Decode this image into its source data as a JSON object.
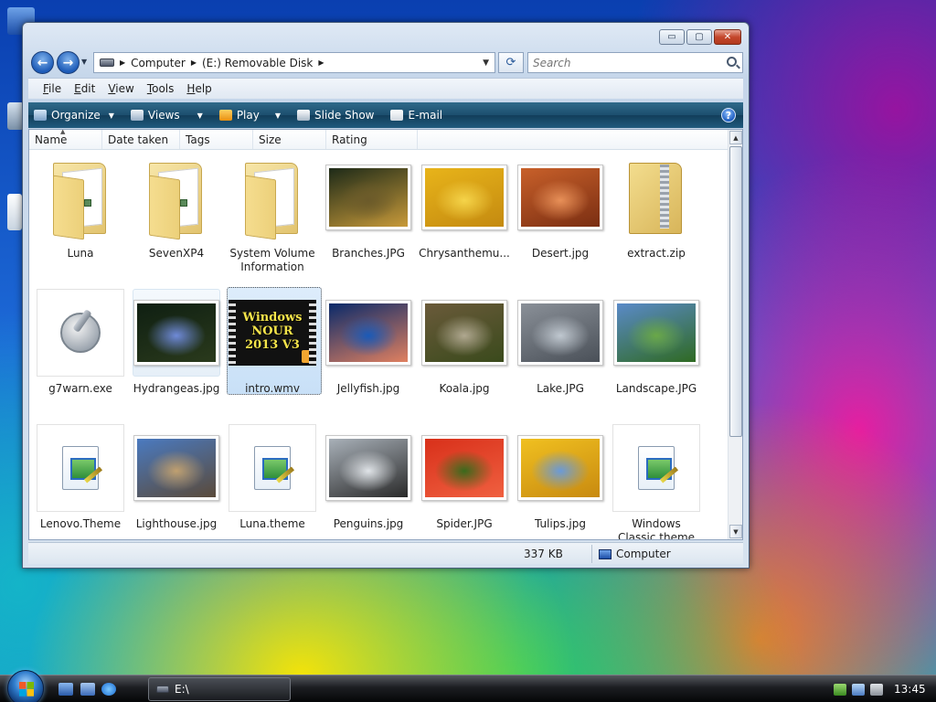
{
  "window": {
    "controls": {
      "minimize": "▭",
      "maximize": "▢",
      "close": "✕"
    }
  },
  "nav": {
    "back_glyph": "←",
    "forward_glyph": "→",
    "breadcrumb": [
      "Computer",
      "(E:) Removable Disk"
    ],
    "search_placeholder": "Search"
  },
  "menu": [
    "File",
    "Edit",
    "View",
    "Tools",
    "Help"
  ],
  "commands": {
    "organize": "Organize",
    "views": "Views",
    "play": "Play",
    "slideshow": "Slide Show",
    "email": "E-mail",
    "help_glyph": "?"
  },
  "columns": [
    "Name",
    "Date taken",
    "Tags",
    "Size",
    "Rating"
  ],
  "items": [
    {
      "name": "Luna",
      "kind": "folder"
    },
    {
      "name": "SevenXP4",
      "kind": "folder"
    },
    {
      "name": "System Volume Information",
      "kind": "folder-empty"
    },
    {
      "name": "Branches.JPG",
      "kind": "photo",
      "colors": [
        "#1d2a18",
        "#6b5a2a",
        "#c89a3a"
      ]
    },
    {
      "name": "Chrysanthemu...",
      "kind": "photo",
      "colors": [
        "#e8b41a",
        "#f5d44a",
        "#c48a10"
      ]
    },
    {
      "name": "Desert.jpg",
      "kind": "photo",
      "colors": [
        "#c8602a",
        "#e89058",
        "#7a2e12"
      ]
    },
    {
      "name": "extract.zip",
      "kind": "zip"
    },
    {
      "name": "g7warn.exe",
      "kind": "exe"
    },
    {
      "name": "Hydrangeas.jpg",
      "kind": "photo",
      "colors": [
        "#0f1f12",
        "#6f8ad8",
        "#2a3a1c"
      ]
    },
    {
      "name": "intro.wmv",
      "kind": "video",
      "overlay": "Windows NOUR 2013 V3"
    },
    {
      "name": "Jellyfish.jpg",
      "kind": "photo",
      "colors": [
        "#0a2a6a",
        "#1a5ab8",
        "#e08060"
      ]
    },
    {
      "name": "Koala.jpg",
      "kind": "photo",
      "colors": [
        "#6a5a3a",
        "#b0a890",
        "#3a4a1c"
      ]
    },
    {
      "name": "Lake.JPG",
      "kind": "photo",
      "colors": [
        "#8a9098",
        "#c0c8d0",
        "#4a5058"
      ]
    },
    {
      "name": "Landscape.JPG",
      "kind": "photo",
      "colors": [
        "#5a8ac8",
        "#6aa848",
        "#2f6a22"
      ]
    },
    {
      "name": "Lenovo.Theme",
      "kind": "theme"
    },
    {
      "name": "Lighthouse.jpg",
      "kind": "photo",
      "colors": [
        "#4a7ac0",
        "#c0a070",
        "#5a4a3a"
      ]
    },
    {
      "name": "Luna.theme",
      "kind": "theme"
    },
    {
      "name": "Penguins.jpg",
      "kind": "photo",
      "colors": [
        "#a8b0b8",
        "#e0e4e8",
        "#2a2a2a"
      ]
    },
    {
      "name": "Spider.JPG",
      "kind": "photo",
      "colors": [
        "#d8301a",
        "#3a6a1c",
        "#f06040"
      ]
    },
    {
      "name": "Tulips.jpg",
      "kind": "photo",
      "colors": [
        "#f0c020",
        "#6a9ad8",
        "#c88a10"
      ]
    },
    {
      "name": "Windows Classic.theme",
      "kind": "theme"
    }
  ],
  "status": {
    "size": "337 KB",
    "location": "Computer"
  },
  "taskbar": {
    "task": "E:\\",
    "clock": "13:45"
  },
  "colors": {
    "accent": "#1c4e6e",
    "selection": "#c8e0f7"
  }
}
